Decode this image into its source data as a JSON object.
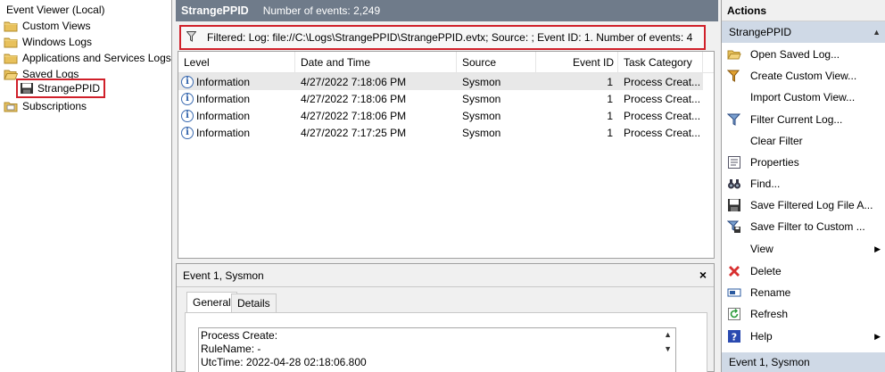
{
  "tree": {
    "root": "Event Viewer (Local)",
    "custom_views": "Custom Views",
    "windows_logs": "Windows Logs",
    "app_services_logs": "Applications and Services Logs",
    "saved_logs": "Saved Logs",
    "strangeppid": "StrangePPID",
    "subscriptions": "Subscriptions"
  },
  "header": {
    "title": "StrangePPID",
    "count": "Number of events: 2,249"
  },
  "filter": {
    "text": "Filtered: Log: file://C:\\Logs\\StrangePPID\\StrangePPID.evtx; Source: ; Event ID: 1. Number of events: 4"
  },
  "grid": {
    "columns": [
      "Level",
      "Date and Time",
      "Source",
      "Event ID",
      "Task Category"
    ],
    "rows": [
      {
        "level": "Information",
        "date": "4/27/2022 7:18:06 PM",
        "source": "Sysmon",
        "event_id": "1",
        "task": "Process Creat..."
      },
      {
        "level": "Information",
        "date": "4/27/2022 7:18:06 PM",
        "source": "Sysmon",
        "event_id": "1",
        "task": "Process Creat..."
      },
      {
        "level": "Information",
        "date": "4/27/2022 7:18:06 PM",
        "source": "Sysmon",
        "event_id": "1",
        "task": "Process Creat..."
      },
      {
        "level": "Information",
        "date": "4/27/2022 7:17:25 PM",
        "source": "Sysmon",
        "event_id": "1",
        "task": "Process Creat..."
      }
    ]
  },
  "detail": {
    "title": "Event 1, Sysmon",
    "close": "×",
    "tabs": [
      "General",
      "Details"
    ],
    "lines": [
      "Process Create:",
      "RuleName: -",
      "UtcTime: 2022-04-28 02:18:06.800"
    ]
  },
  "actions": {
    "title": "Actions",
    "section1": "StrangePPID",
    "items": [
      {
        "label": "Open Saved Log...",
        "icon": "open-folder-icon"
      },
      {
        "label": "Create Custom View...",
        "icon": "filter-create-icon"
      },
      {
        "label": "Import Custom View...",
        "icon": ""
      },
      {
        "label": "Filter Current Log...",
        "icon": "filter-icon"
      },
      {
        "label": "Clear Filter",
        "icon": ""
      },
      {
        "label": "Properties",
        "icon": "properties-icon"
      },
      {
        "label": "Find...",
        "icon": "binoculars-icon"
      },
      {
        "label": "Save Filtered Log File A...",
        "icon": "save-icon"
      },
      {
        "label": "Save Filter to Custom ...",
        "icon": "save-filter-icon"
      },
      {
        "label": "View",
        "icon": ""
      },
      {
        "label": "Delete",
        "icon": "delete-icon"
      },
      {
        "label": "Rename",
        "icon": "rename-icon"
      },
      {
        "label": "Refresh",
        "icon": "refresh-icon"
      },
      {
        "label": "Help",
        "icon": "help-icon"
      }
    ],
    "section2": "Event 1, Sysmon"
  },
  "colors": {
    "header_bar": "#6f7b8a",
    "highlight_border": "#d0202a",
    "section_bar": "#cfd9e6"
  }
}
